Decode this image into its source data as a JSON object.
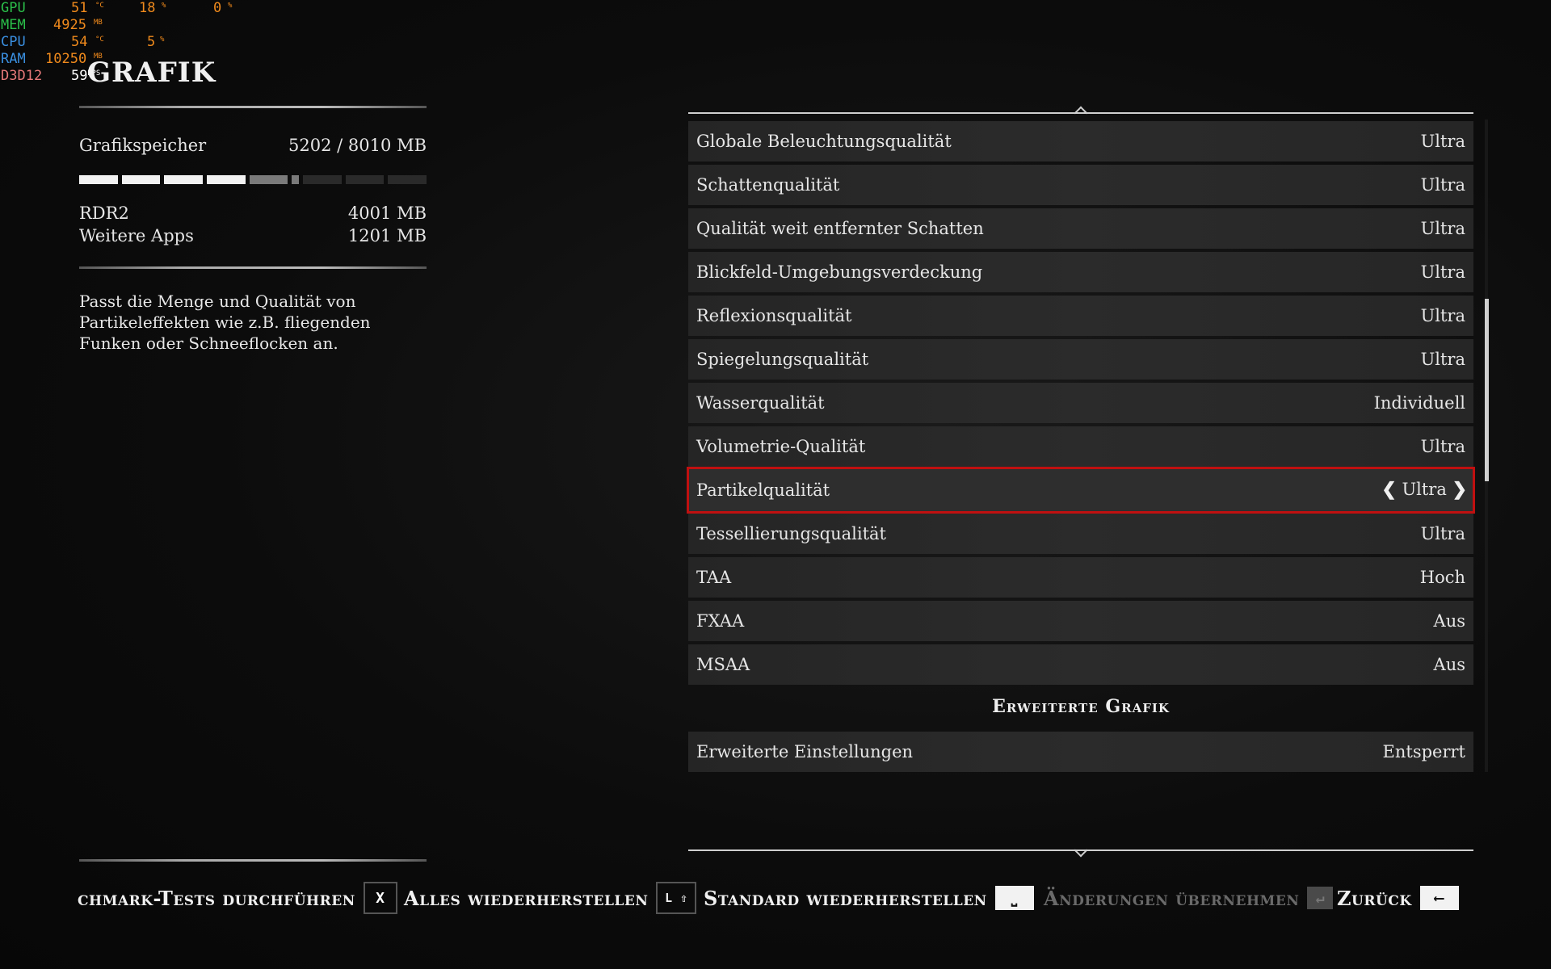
{
  "overlay": {
    "gpu": {
      "label": "GPU",
      "val1": "51",
      "unit1": "°C",
      "val2": "18",
      "unit2": "%",
      "val3": "0",
      "unit3": "%"
    },
    "mem": {
      "label": "MEM",
      "val1": "4925",
      "unit1": "MB"
    },
    "cpu": {
      "label": "CPU",
      "val1": "54",
      "unit1": "°C",
      "val2": "5",
      "unit2": "%"
    },
    "ram": {
      "label": "RAM",
      "val1": "10250",
      "unit1": "MB"
    },
    "d3d": {
      "label": "D3D12",
      "val1": "59",
      "unit1": "FPS"
    }
  },
  "title": "GRAFIK",
  "memory": {
    "label": "Grafikspeicher",
    "used": "5202",
    "total": "/ 8010",
    "unit": "MB",
    "used_fraction": 0.65,
    "apps": [
      {
        "name": "RDR2",
        "value": "4001",
        "unit": "MB"
      },
      {
        "name": "Weitere Apps",
        "value": "1201",
        "unit": "MB"
      }
    ]
  },
  "description": "Passt die Menge und Qualität von Partikeleffekten wie z.B. fliegenden Funken oder Schneeflocken an.",
  "settings": [
    {
      "label": "Globale Beleuchtungsqualität",
      "value": "Ultra"
    },
    {
      "label": "Schattenqualität",
      "value": "Ultra"
    },
    {
      "label": "Qualität weit entfernter Schatten",
      "value": "Ultra"
    },
    {
      "label": "Blickfeld-Umgebungsverdeckung",
      "value": "Ultra"
    },
    {
      "label": "Reflexionsqualität",
      "value": "Ultra"
    },
    {
      "label": "Spiegelungsqualität",
      "value": "Ultra"
    },
    {
      "label": "Wasserqualität",
      "value": "Individuell"
    },
    {
      "label": "Volumetrie-Qualität",
      "value": "Ultra"
    },
    {
      "label": "Partikelqualität",
      "value": "Ultra",
      "selected": true
    },
    {
      "label": "Tessellierungsqualität",
      "value": "Ultra"
    },
    {
      "label": "TAA",
      "value": "Hoch"
    },
    {
      "label": "FXAA",
      "value": "Aus"
    },
    {
      "label": "MSAA",
      "value": "Aus"
    }
  ],
  "section": "Erweiterte Grafik",
  "advanced": {
    "label": "Erweiterte Einstellungen",
    "value": "Entsperrt"
  },
  "footer": {
    "benchmark": "chmark-Tests durchführen",
    "benchmark_key": "X",
    "restore_all": "Alles wiederherstellen",
    "restore_all_key": "L ⇧",
    "restore_default": "Standard wiederherstellen",
    "restore_default_key": "⎵",
    "apply": "Änderungen übernehmen",
    "apply_key": "↵",
    "back": "Zurück",
    "back_key": "⟵"
  }
}
